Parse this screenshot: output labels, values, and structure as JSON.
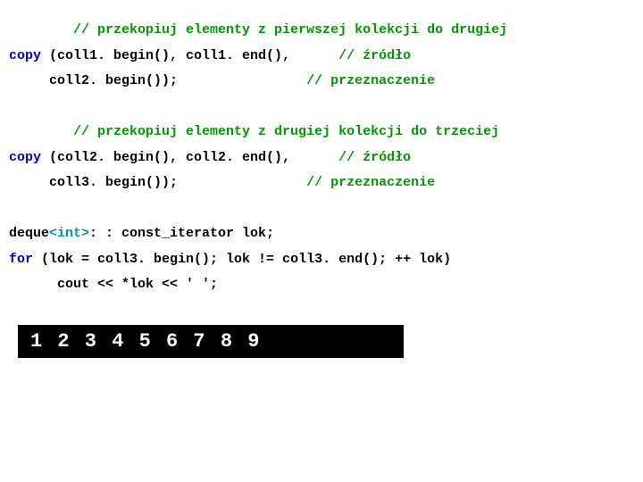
{
  "code": {
    "c1": "// przekopiuj elementy z pierwszej kolekcji do drugiej",
    "copy_kw": "copy",
    "l2a": " (coll1. begin(), coll1. end(),      ",
    "l2c": "// źródło",
    "l3a": "     coll2. begin());                ",
    "l3c": "// przeznaczenie",
    "c2": "// przekopiuj elementy z drugiej kolekcji do trzeciej",
    "l5a": " (coll2. begin(), coll2. end(),      ",
    "l5c": "// źródło",
    "l6a": "     coll3. begin());                ",
    "l6c": "// przeznaczenie",
    "l7a": "deque",
    "l7t": "<int>",
    "l7b": ": : const_iterator lok;",
    "for_kw": "for",
    "l8": " (lok = coll3. begin(); lok != coll3. end(); ++ lok)",
    "l9": "      cout << *lok << ' ';"
  },
  "output": "1 2 3 4 5 6 7 8 9"
}
